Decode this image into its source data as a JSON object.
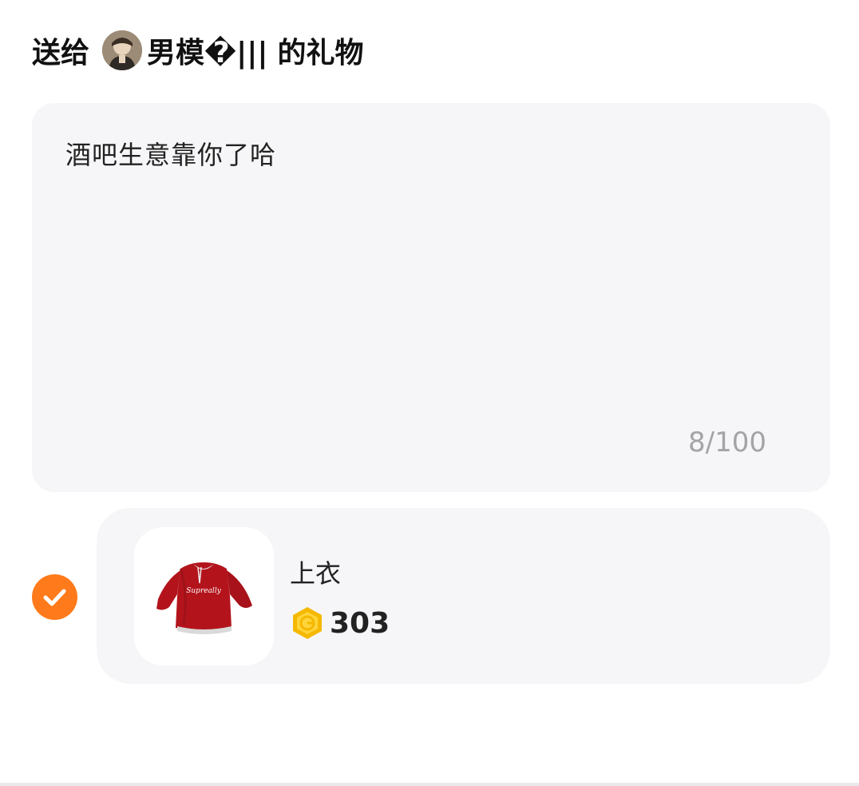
{
  "header": {
    "prefix": "送给",
    "recipient_name": "男模�|||",
    "suffix": "的礼物"
  },
  "message": {
    "text": "酒吧生意靠你了哈",
    "counter": "8/100"
  },
  "gift": {
    "name": "上衣",
    "price": "303",
    "selected": true,
    "image_print": "Supreally"
  },
  "colors": {
    "accent": "#ff7a1a",
    "coin": "#f5b800",
    "card_bg": "#f6f6f8",
    "shirt_red": "#b3141c"
  },
  "icons": {
    "check": "checkmark-icon",
    "coin": "coin-icon"
  }
}
